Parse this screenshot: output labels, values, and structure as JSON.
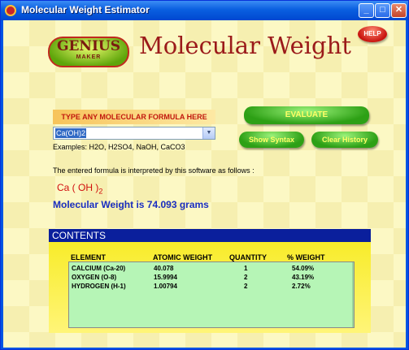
{
  "window": {
    "title": "Molecular Weight Estimator",
    "controls": {
      "minimize": "_",
      "maximize": "□",
      "close": "✕"
    }
  },
  "header": {
    "logo_top": "GENIUS",
    "logo_bottom": "MAKER",
    "app_title": "Molecular Weight",
    "help_label": "HELP"
  },
  "input": {
    "prompt_label": "TYPE ANY MOLECULAR FORMULA HERE",
    "formula_value": "Ca(OH)2",
    "examples": "Examples:  H2O, H2SO4, NaOH, CaCO3"
  },
  "buttons": {
    "evaluate": "EVALUATE",
    "show_syntax": "Show Syntax",
    "clear_history": "Clear History"
  },
  "result": {
    "interpretation_text": "The entered formula is interpreted by this software as follows :",
    "formula_display": "Ca ( OH )",
    "formula_subscript": "2",
    "molecular_weight_text": "Molecular Weight is 74.093 grams"
  },
  "contents": {
    "title": "CONTENTS",
    "headers": {
      "element": "ELEMENT",
      "atomic_weight": "ATOMIC WEIGHT",
      "quantity": "QUANTITY",
      "percent_weight": "% WEIGHT"
    },
    "rows": [
      {
        "element": "CALCIUM (Ca-20)",
        "atomic_weight": "40.078",
        "quantity": "1",
        "percent_weight": "54.09%"
      },
      {
        "element": "OXYGEN (O-8)",
        "atomic_weight": "15.9994",
        "quantity": "2",
        "percent_weight": "43.19%"
      },
      {
        "element": "HYDROGEN (H-1)",
        "atomic_weight": "1.00794",
        "quantity": "2",
        "percent_weight": "2.72%"
      }
    ]
  },
  "colors": {
    "title_red": "#9b1a1a",
    "result_blue": "#1a2ec0",
    "button_green": "#2da015",
    "panel_yellow": "#f8ec2a",
    "table_green": "#b6f5b6"
  }
}
